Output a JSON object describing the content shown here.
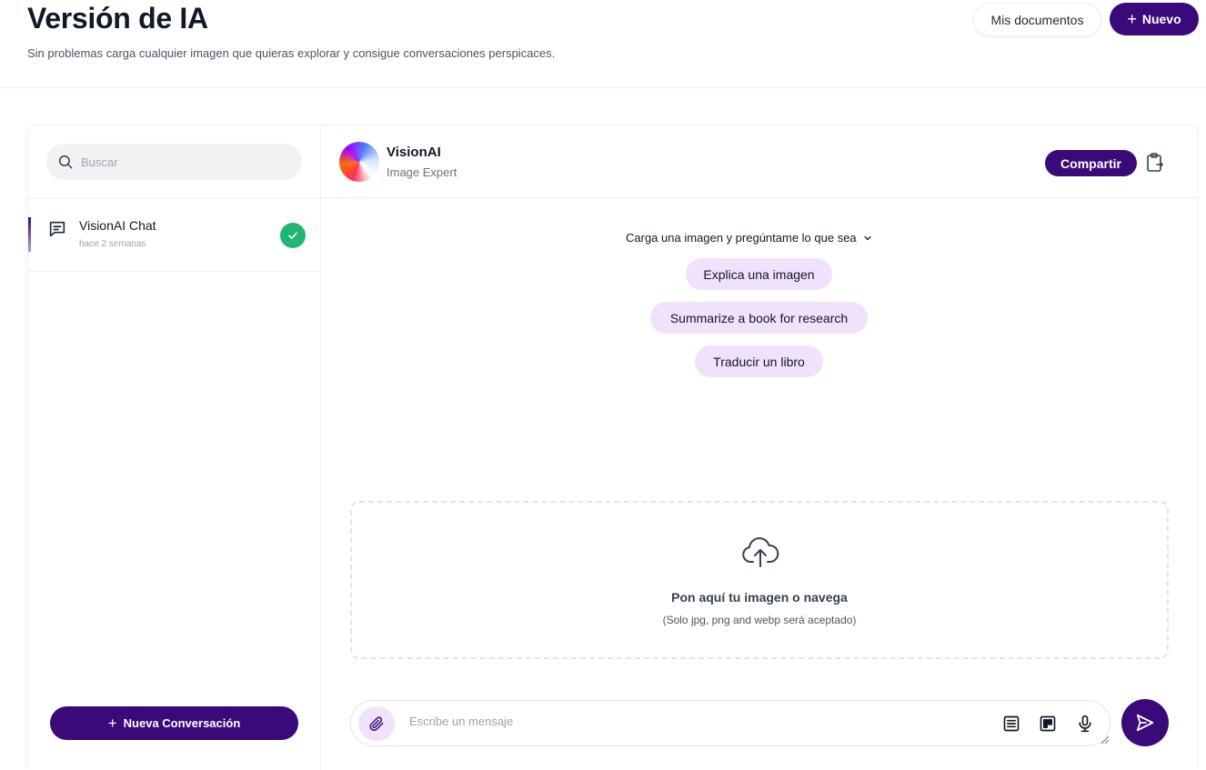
{
  "header": {
    "title": "Versión de IA",
    "subtitle": "Sin problemas carga cualquier imagen que quieras explorar y consigue conversaciones perspicaces.",
    "my_docs_label": "Mis documentos",
    "new_label": "Nuevo",
    "new_icon": "plus-icon"
  },
  "sidebar": {
    "search_placeholder": "Buscar",
    "search_icon": "search-icon",
    "conversations": [
      {
        "title": "VisionAI Chat",
        "time": "hace 2 semanas",
        "icon": "chat-icon",
        "status_icon": "check-icon"
      }
    ],
    "new_conversation_label": "Nueva Conversación"
  },
  "chat": {
    "agent_name": "VisionAI",
    "agent_role": "Image Expert",
    "share_label": "Compartir",
    "prompt_toggle": "Carga una imagen y pregúntame lo que sea",
    "suggestions": [
      "Explica una imagen",
      "Summarize a book for research",
      "Traducir un libro"
    ],
    "dropzone": {
      "title": "Pon aquí tu imagen o navega",
      "subtitle": "(Solo jpg, png and webp será aceptado)",
      "icon": "cloud-upload-icon"
    },
    "composer": {
      "placeholder": "Escribe un mensaje",
      "tools": [
        "list-icon",
        "board-icon",
        "microphone-icon"
      ],
      "attach_icon": "paperclip-icon",
      "send_icon": "send-icon"
    }
  },
  "colors": {
    "brand": "#3b0a7a",
    "suggestion_bg": "#f0e2fb",
    "success": "#22b573"
  }
}
